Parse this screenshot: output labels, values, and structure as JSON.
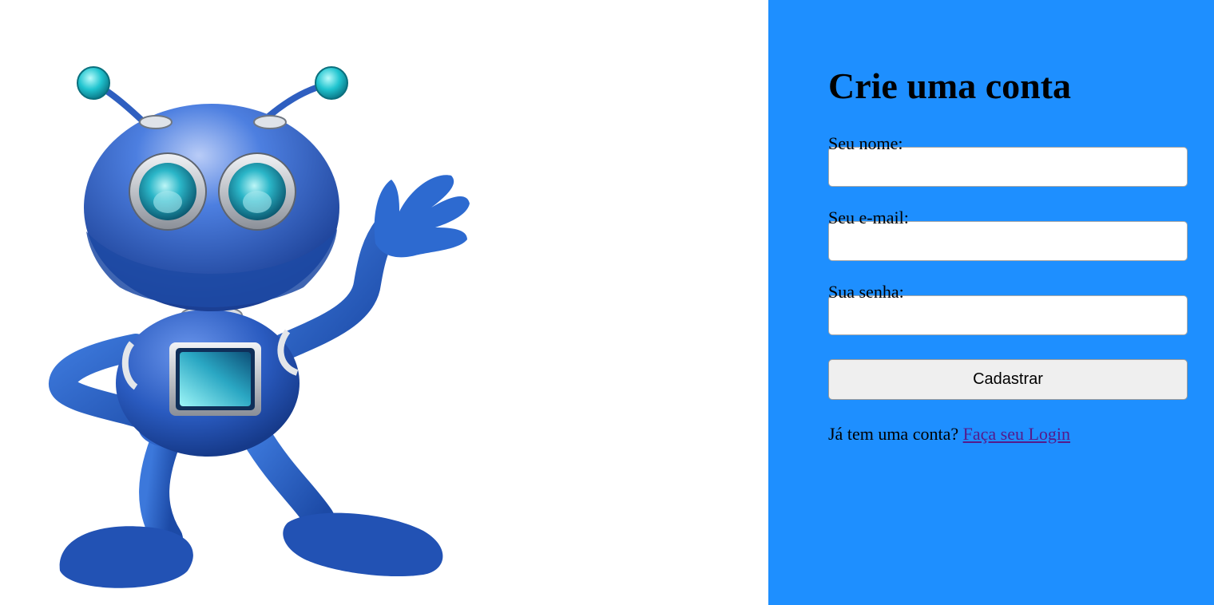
{
  "illustration": {
    "icon": "waving-robot-icon"
  },
  "form": {
    "title": "Crie uma conta",
    "name_label": "Seu nome:",
    "name_value": "",
    "email_label": "Seu e-mail:",
    "email_value": "",
    "password_label": "Sua senha:",
    "password_value": "",
    "submit_label": "Cadastrar",
    "login_prompt": "Já tem uma conta?",
    "login_link": "Faça seu Login"
  },
  "colors": {
    "panel_background": "#1e8fff",
    "robot_blue": "#2a63c4",
    "robot_cyan": "#27c8d6",
    "link": "#551a8b"
  }
}
